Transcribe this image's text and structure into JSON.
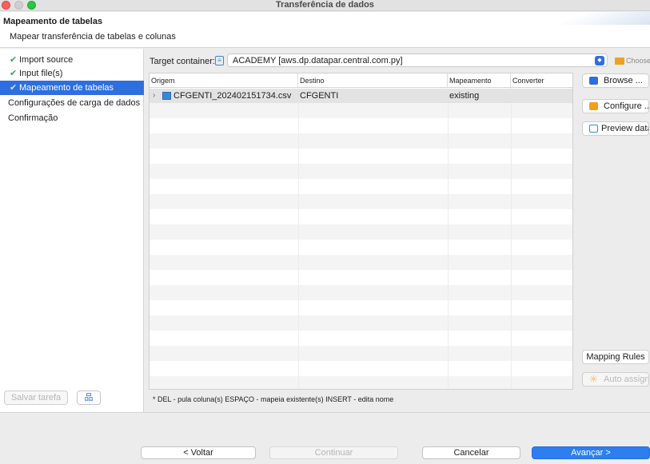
{
  "window": {
    "title": "Transferência de dados"
  },
  "header": {
    "title": "Mapeamento de tabelas",
    "subtitle": "Mapear transferência de tabelas e colunas"
  },
  "sidebar": {
    "items": [
      {
        "label": "Import source",
        "checked": true,
        "active": false
      },
      {
        "label": "Input file(s)",
        "checked": true,
        "active": false
      },
      {
        "label": "Mapeamento de tabelas",
        "checked": true,
        "active": true
      },
      {
        "label": "Configurações de carga de dados",
        "checked": false,
        "active": false
      },
      {
        "label": "Confirmação",
        "checked": false,
        "active": false
      }
    ],
    "save_task_label": "Salvar tarefa"
  },
  "target": {
    "label": "Target container:",
    "value": "ACADEMY  [aws.dp.datapar.central.com.py]",
    "choose_label": "Choose"
  },
  "table": {
    "columns": [
      "Origem",
      "Destino",
      "Mapeamento",
      "Converter"
    ],
    "rows": [
      {
        "origem": "CFGENTI_202402151734.csv",
        "destino": "CFGENTI",
        "mapeamento": "existing",
        "converter": ""
      }
    ]
  },
  "side_buttons": {
    "browse": "Browse ...",
    "configure": "Configure ...",
    "preview": "Preview data",
    "mapping_rules": "Mapping Rules",
    "auto_assign": "Auto assign"
  },
  "hint": "* DEL - pula coluna(s)  ESPAÇO - mapeia existente(s)  INSERT - edita nome",
  "footer": {
    "back": "< Voltar",
    "continue": "Continuar",
    "cancel": "Cancelar",
    "next": "Avançar >"
  }
}
